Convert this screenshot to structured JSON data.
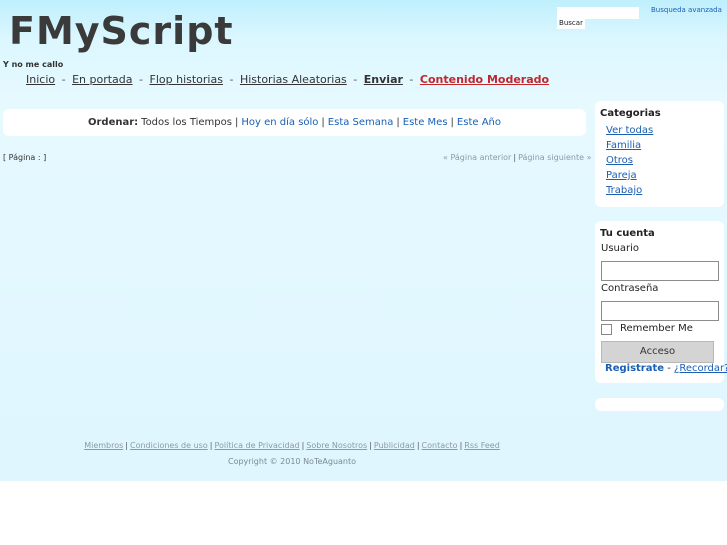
{
  "header": {
    "logo": "FMyScript",
    "tagline": "Y no me callo",
    "search_button": "Buscar",
    "advanced_search": "Busqueda avanzada"
  },
  "nav": {
    "items": [
      "Inicio",
      "En portada",
      "Flop historias",
      "Historias Aleatorias",
      "Enviar",
      "Contenido Moderado"
    ],
    "separator": "-"
  },
  "order": {
    "label": "Ordenar:",
    "current": "Todos los Tiempos",
    "options": [
      "Hoy en día sólo",
      "Esta Semana",
      "Este Mes",
      "Este Año"
    ],
    "separator": "|"
  },
  "pagination": {
    "page_info": "[ Página : ]",
    "prev": "« Página anterior",
    "next": "Página siguiente »"
  },
  "categories": {
    "title": "Categorias",
    "items": [
      "Ver todas",
      "Familia",
      "Otros",
      "Pareja",
      "Trabajo"
    ]
  },
  "account": {
    "title": "Tu cuenta",
    "user_label": "Usuario",
    "user_value": "",
    "password_label": "Contraseña",
    "password_value": "",
    "remember_label": "Remember Me",
    "remember_checked": false,
    "login_button": "Acceso",
    "register": "Registrate",
    "dash": "-",
    "recover": "¿Recordar?"
  },
  "footer": {
    "links": [
      "Miembros",
      "Condiciones de uso",
      "Política de Privacidad",
      "Sobre Nosotros",
      "Publicidad",
      "Contacto",
      "Rss Feed"
    ],
    "copyright": "Copyright © 2010 NoTeAguanto"
  },
  "colors": {
    "background": "#dff6ff",
    "link": "#1a5fb4",
    "moderado": "#c0262c",
    "panel": "#ffffff"
  }
}
